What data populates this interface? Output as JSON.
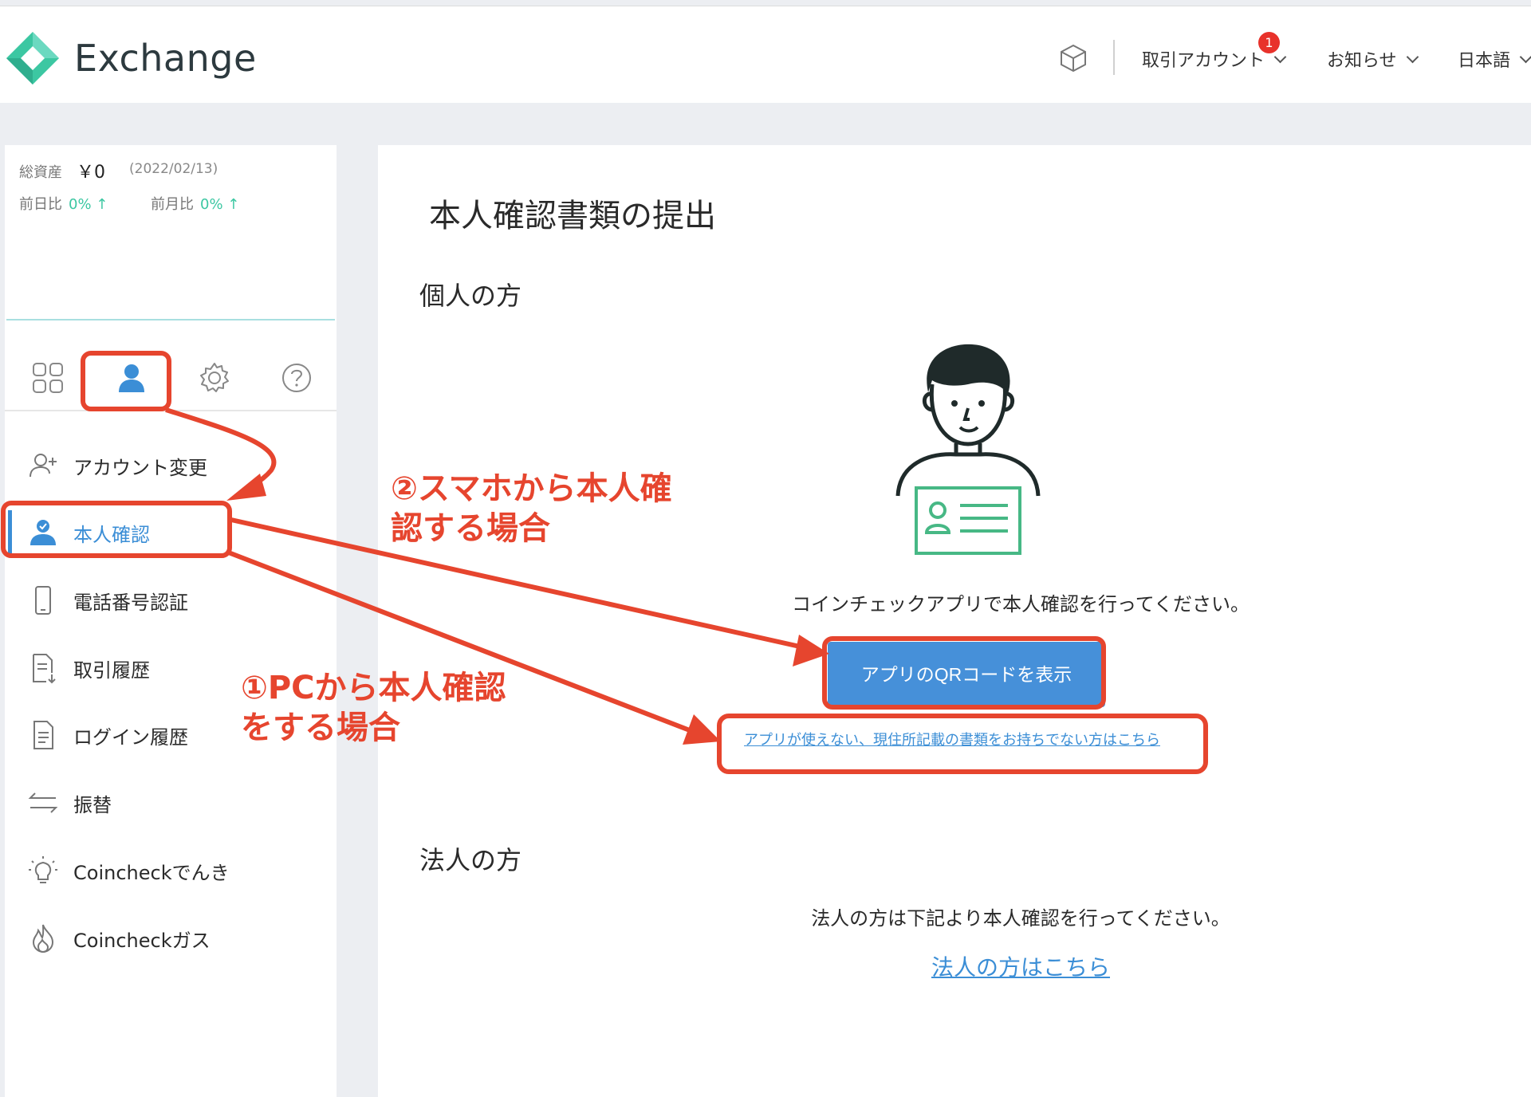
{
  "header": {
    "brand": "Exchange",
    "nav": {
      "account": "取引アカウント",
      "account_badge": "1",
      "notices": "お知らせ",
      "language": "日本語"
    }
  },
  "sidebar": {
    "assets_label": "総資産",
    "assets_value": "￥0",
    "assets_date": "(2022/02/13)",
    "day_compare_label": "前日比",
    "day_compare_value": "0% ↑",
    "month_compare_label": "前月比",
    "month_compare_value": "0% ↑",
    "tabs": [
      "grid-icon",
      "user-icon",
      "gear-icon",
      "help-icon"
    ],
    "menu": [
      {
        "label": "アカウント変更",
        "icon": "user-plus-icon"
      },
      {
        "label": "本人確認",
        "icon": "user-verified-icon"
      },
      {
        "label": "電話番号認証",
        "icon": "phone-icon"
      },
      {
        "label": "取引履歴",
        "icon": "trade-history-icon"
      },
      {
        "label": "ログイン履歴",
        "icon": "document-icon"
      },
      {
        "label": "振替",
        "icon": "transfer-icon"
      },
      {
        "label": "Coincheckでんき",
        "icon": "bulb-icon"
      },
      {
        "label": "Coincheckガス",
        "icon": "flame-icon"
      }
    ]
  },
  "main": {
    "title": "本人確認書類の提出",
    "individual_heading": "個人の方",
    "individual_instruction": "コインチェックアプリで本人確認を行ってください。",
    "qr_button": "アプリのQRコードを表示",
    "alt_link": "アプリが使えない、現住所記載の書類をお持ちでない方はこちら",
    "corporate_heading": "法人の方",
    "corporate_instruction": "法人の方は下記より本人確認を行ってください。",
    "corporate_link": "法人の方はこちら"
  },
  "annotations": {
    "smartphone_line1": "②スマホから本人確",
    "smartphone_line2": "認する場合",
    "pc_line1": "①PCから本人確認",
    "pc_line2": "をする場合"
  },
  "colors": {
    "accent_blue": "#3b8ed6",
    "button_blue": "#4690d9",
    "annotation_red": "#e6452e",
    "teal_green": "#3cc7a2"
  }
}
